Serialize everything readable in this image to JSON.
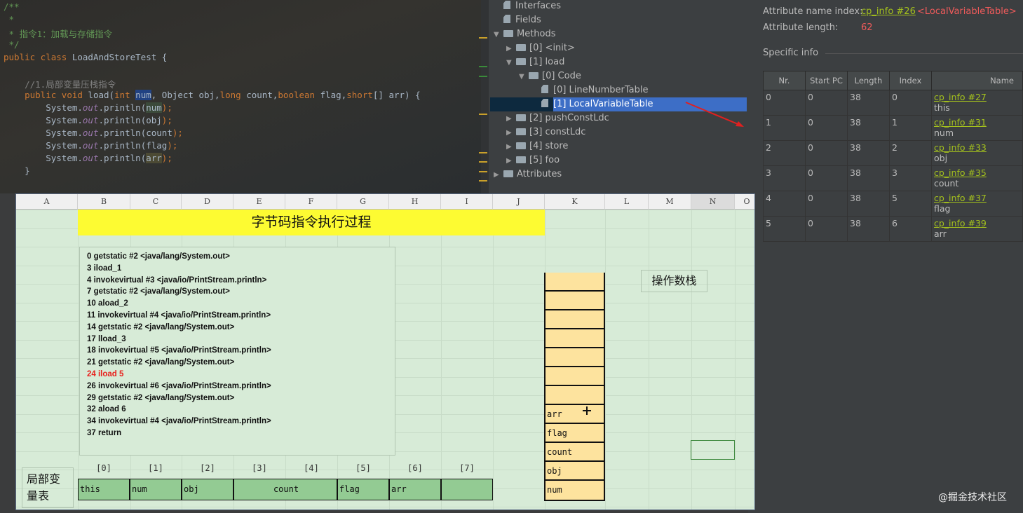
{
  "editor": {
    "lines": [
      {
        "text": "/**",
        "cls": "cm"
      },
      {
        "text": " *",
        "cls": "cm"
      },
      {
        "text": " * 指令1：加载与存储指令",
        "cls": "cm"
      },
      {
        "text": " */",
        "cls": "cm"
      },
      {
        "kw": "public class ",
        "name": "LoadAndStoreTest",
        " rest": " {"
      },
      {
        "text": "    //1.局部变量压栈指令",
        "cls": "gr"
      }
    ],
    "signature": {
      "kw1": "public void ",
      "name": "load",
      "p1": "int ",
      "num": "num",
      "p2": ", Object obj,",
      "kw2": "long ",
      "p3": "count,",
      "kw3": "boolean ",
      "p4": "flag,",
      "kw4": "short",
      "p5": "[] arr) {"
    },
    "prints": [
      "num",
      "obj",
      "count",
      "flag",
      "arr"
    ],
    "system": "System.",
    "out": "out",
    "println": ".println(",
    "close": ");",
    "brace": "}"
  },
  "tree": {
    "items": [
      {
        "label": "Interfaces",
        "type": "file",
        "level": 0
      },
      {
        "label": "Fields",
        "type": "file",
        "level": 0
      },
      {
        "label": "Methods",
        "type": "folder",
        "level": 0,
        "expanded": true
      },
      {
        "label": "[0] <init>",
        "type": "folder",
        "level": 1
      },
      {
        "label": "[1] load",
        "type": "folder",
        "level": 1,
        "expanded": true
      },
      {
        "label": "[0] Code",
        "type": "folder",
        "level": 2,
        "expanded": true
      },
      {
        "label": "[0] LineNumberTable",
        "type": "file",
        "level": 3
      },
      {
        "label": "[1] LocalVariableTable",
        "type": "file",
        "level": 3,
        "selected": true
      },
      {
        "label": "[2] pushConstLdc",
        "type": "folder",
        "level": 1
      },
      {
        "label": "[3] constLdc",
        "type": "folder",
        "level": 1
      },
      {
        "label": "[4] store",
        "type": "folder",
        "level": 1
      },
      {
        "label": "[5] foo",
        "type": "folder",
        "level": 1
      },
      {
        "label": "Attributes",
        "type": "folder",
        "level": 0
      }
    ]
  },
  "attr": {
    "name_index_label": "Attribute name index:",
    "name_index_link": "cp_info #26",
    "name_index_value": "<LocalVariableTable>",
    "length_label": "Attribute length:",
    "length_value": "62",
    "specific_info": "Specific info",
    "columns": [
      "Nr.",
      "Start PC",
      "Length",
      "Index",
      "Name"
    ],
    "rows": [
      {
        "nr": "0",
        "start": "0",
        "len": "38",
        "idx": "0",
        "link": "cp_info #27",
        "name": "this"
      },
      {
        "nr": "1",
        "start": "0",
        "len": "38",
        "idx": "1",
        "link": "cp_info #31",
        "name": "num"
      },
      {
        "nr": "2",
        "start": "0",
        "len": "38",
        "idx": "2",
        "link": "cp_info #33",
        "name": "obj"
      },
      {
        "nr": "3",
        "start": "0",
        "len": "38",
        "idx": "3",
        "link": "cp_info #35",
        "name": "count"
      },
      {
        "nr": "4",
        "start": "0",
        "len": "38",
        "idx": "5",
        "link": "cp_info #37",
        "name": "flag"
      },
      {
        "nr": "5",
        "start": "0",
        "len": "38",
        "idx": "6",
        "link": "cp_info #39",
        "name": "arr"
      }
    ]
  },
  "sheet": {
    "columns": [
      "A",
      "B",
      "C",
      "D",
      "E",
      "F",
      "G",
      "H",
      "I",
      "J",
      "K",
      "L",
      "M",
      "N",
      "O"
    ],
    "title": "字节码指令执行过程",
    "instructions": [
      "0 getstatic #2 <java/lang/System.out>",
      "3 iload_1",
      "4 invokevirtual #3 <java/io/PrintStream.println>",
      "7 getstatic #2 <java/lang/System.out>",
      "10 aload_2",
      "11 invokevirtual #4 <java/io/PrintStream.println>",
      "14 getstatic #2 <java/lang/System.out>",
      "17 lload_3",
      "18 invokevirtual #5 <java/io/PrintStream.println>",
      "21 getstatic #2 <java/lang/System.out>",
      "24 iload 5",
      "26 invokevirtual #6 <java/io/PrintStream.println>",
      "29 getstatic #2 <java/lang/System.out>",
      "32 aload 6",
      "34 invokevirtual #4 <java/io/PrintStream.println>",
      "37 return"
    ],
    "current_instruction": 10,
    "stack_label": "操作数栈",
    "stack": [
      "arr",
      "flag",
      "count",
      "obj",
      "num"
    ],
    "stack_slots": 12,
    "lv_label": "局部变量表",
    "lv_indices": [
      "[0]",
      "[1]",
      "[2]",
      "[3]",
      "[4]",
      "[5]",
      "[6]",
      "[7]"
    ],
    "lv_cells": [
      "this",
      "num",
      "obj",
      "count",
      "flag",
      "arr",
      ""
    ]
  },
  "watermark": "@掘金技术社区",
  "colors": {
    "link": "#a4c11d",
    "value_red": "#f05b5b",
    "title_yellow": "#fdfb32",
    "stack_cell": "#fde39e",
    "lv_cell": "#93cb93",
    "selection": "#3d6ec6"
  }
}
